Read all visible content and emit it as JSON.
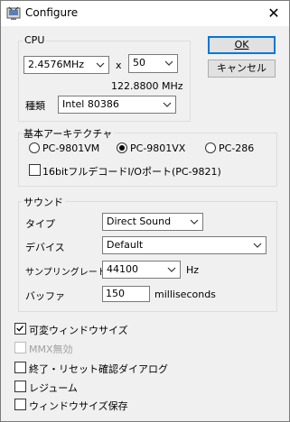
{
  "window": {
    "title": "Configure",
    "close_glyph": "✕",
    "icon": "app-icon"
  },
  "cpu": {
    "legend": "CPU",
    "clock": "2.4576MHz",
    "times": "x",
    "multiplier": "50",
    "effective": "122.8800 MHz",
    "type_label": "種類",
    "type_value": "Intel 80386"
  },
  "buttons": {
    "ok": "OK",
    "cancel": "キャンセル"
  },
  "arch": {
    "legend": "基本アーキテクチャ",
    "options": [
      "PC-9801VM",
      "PC-9801VX",
      "PC-286"
    ],
    "selected": "PC-9801VX",
    "fulldecode": "16bitフルデコードI/Oポート(PC-9821)"
  },
  "sound": {
    "legend": "サウンド",
    "type_label": "タイプ",
    "type_value": "Direct Sound",
    "device_label": "デバイス",
    "device_value": "Default",
    "rate_label": "サンプリングレート",
    "rate_value": "44100",
    "rate_unit": "Hz",
    "buffer_label": "バッファ",
    "buffer_value": "150",
    "buffer_unit": "milliseconds"
  },
  "options": {
    "resizable": "可変ウィンドウサイズ",
    "resizable_checked": "true",
    "mmx": "MMX無効",
    "confirm": "終了・リセット確認ダイアログ",
    "resume": "レジューム",
    "save_size": "ウィンドウサイズ保存"
  },
  "colors": {
    "accent": "#0078d7",
    "dialog_bg": "#f0f0f0"
  }
}
